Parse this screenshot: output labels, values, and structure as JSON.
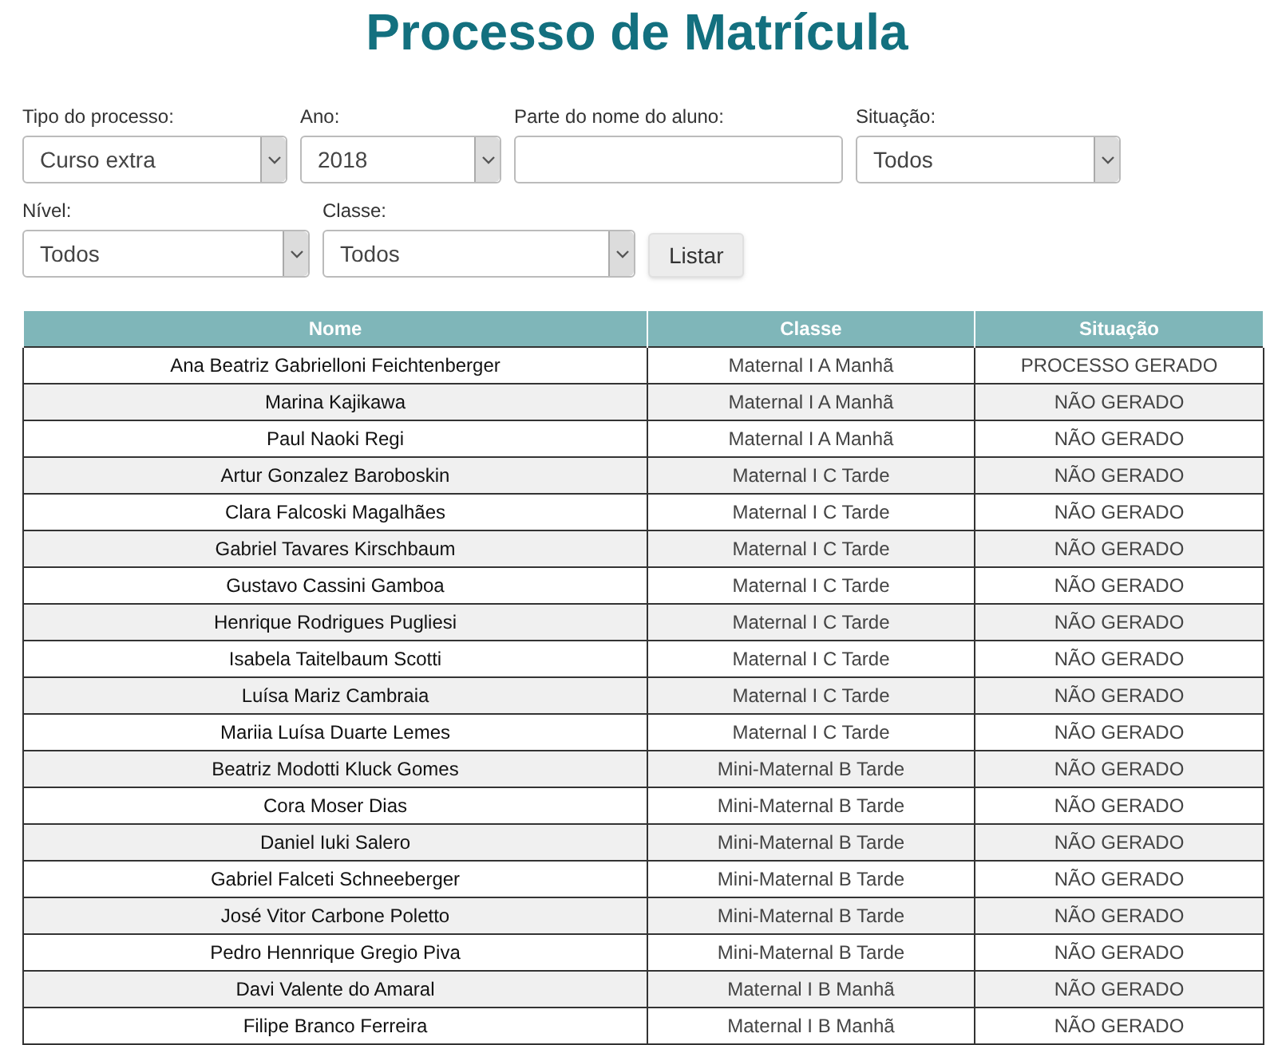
{
  "title": "Processo de Matrícula",
  "filter_rows": [
    [
      {
        "kind": "select",
        "label": "Tipo do processo:",
        "value": "Curso extra"
      },
      {
        "kind": "select",
        "label": "Ano:",
        "value": "2018"
      },
      {
        "kind": "text",
        "label": "Parte do nome do aluno:"
      },
      {
        "kind": "select",
        "label": "Situação:",
        "value": "Todos"
      }
    ],
    [
      {
        "kind": "select",
        "label": "Nível:",
        "value": "Todos"
      },
      {
        "kind": "select",
        "label": "Classe:",
        "value": "Todos"
      },
      {
        "kind": "button",
        "value": "Listar"
      }
    ]
  ],
  "table": {
    "columns": [
      "Nome",
      "Classe",
      "Situação"
    ],
    "rows": [
      [
        "Ana Beatriz Gabrielloni Feichtenberger",
        "Maternal I A Manhã",
        "PROCESSO GERADO"
      ],
      [
        "Marina Kajikawa",
        "Maternal I A Manhã",
        "NÃO GERADO"
      ],
      [
        "Paul Naoki Regi",
        "Maternal I A Manhã",
        "NÃO GERADO"
      ],
      [
        "Artur Gonzalez Baroboskin",
        "Maternal I C Tarde",
        "NÃO GERADO"
      ],
      [
        "Clara Falcoski Magalhães",
        "Maternal I C Tarde",
        "NÃO GERADO"
      ],
      [
        "Gabriel Tavares Kirschbaum",
        "Maternal I C Tarde",
        "NÃO GERADO"
      ],
      [
        "Gustavo Cassini Gamboa",
        "Maternal I C Tarde",
        "NÃO GERADO"
      ],
      [
        "Henrique Rodrigues Pugliesi",
        "Maternal I C Tarde",
        "NÃO GERADO"
      ],
      [
        "Isabela Taitelbaum Scotti",
        "Maternal I C Tarde",
        "NÃO GERADO"
      ],
      [
        "Luísa Mariz Cambraia",
        "Maternal I C Tarde",
        "NÃO GERADO"
      ],
      [
        "Mariia Luísa Duarte Lemes",
        "Maternal I C Tarde",
        "NÃO GERADO"
      ],
      [
        "Beatriz Modotti Kluck Gomes",
        "Mini-Maternal B Tarde",
        "NÃO GERADO"
      ],
      [
        "Cora Moser Dias",
        "Mini-Maternal B Tarde",
        "NÃO GERADO"
      ],
      [
        "Daniel Iuki Salero",
        "Mini-Maternal B Tarde",
        "NÃO GERADO"
      ],
      [
        "Gabriel Falceti Schneeberger",
        "Mini-Maternal B Tarde",
        "NÃO GERADO"
      ],
      [
        "José Vitor Carbone Poletto",
        "Mini-Maternal B Tarde",
        "NÃO GERADO"
      ],
      [
        "Pedro Hennrique Gregio Piva",
        "Mini-Maternal B Tarde",
        "NÃO GERADO"
      ],
      [
        "Davi Valente do Amaral",
        "Maternal I B Manhã",
        "NÃO GERADO"
      ],
      [
        "Filipe Branco Ferreira",
        "Maternal I B Manhã",
        "NÃO GERADO"
      ]
    ]
  }
}
